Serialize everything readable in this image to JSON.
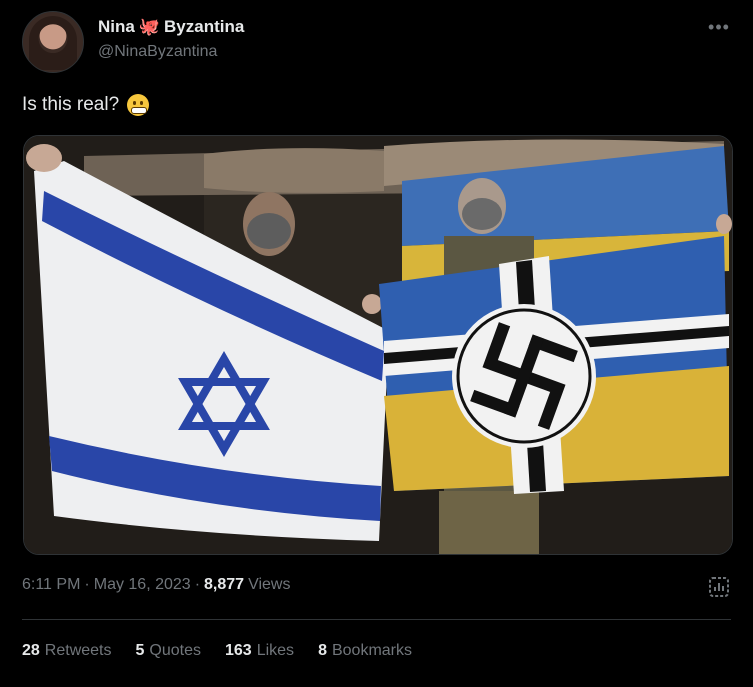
{
  "author": {
    "display_name_first": "Nina",
    "display_name_icon": "octopus-icon",
    "display_name_last": "Byzantina",
    "handle": "@NinaByzantina"
  },
  "more_icon": "more-dots-icon",
  "tweet": {
    "text": "Is this real?",
    "emoji_icon": "grimacing-face-icon"
  },
  "media": {
    "description_icon": "photo-two-people-holding-flags"
  },
  "meta": {
    "time": "6:11 PM",
    "separator": "·",
    "date": "May 16, 2023",
    "views_count": "8,877",
    "views_label": "Views"
  },
  "stats": [
    {
      "count": "28",
      "label": "Retweets"
    },
    {
      "count": "5",
      "label": "Quotes"
    },
    {
      "count": "163",
      "label": "Likes"
    },
    {
      "count": "8",
      "label": "Bookmarks"
    }
  ],
  "colors": {
    "background": "#000000",
    "text_primary": "#e7e9ea",
    "text_secondary": "#71767b",
    "divider": "#2f3336"
  }
}
